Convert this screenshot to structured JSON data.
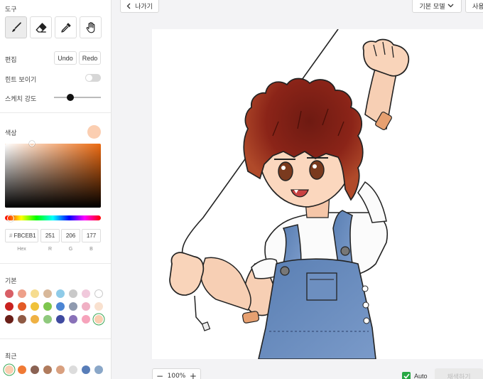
{
  "sidebar": {
    "tools_title": "도구",
    "tools": [
      {
        "name": "brush",
        "active": true
      },
      {
        "name": "eraser",
        "active": false
      },
      {
        "name": "eyedropper",
        "active": false
      },
      {
        "name": "hand",
        "active": false
      }
    ],
    "edit_title": "편집",
    "undo_label": "Undo",
    "redo_label": "Redo",
    "hint_label": "힌트 보이기",
    "hint_enabled": false,
    "strength_label": "스케치 강도",
    "strength_value": 0.35,
    "color_title": "색상",
    "current_color": "#FBCEB1",
    "hex_prefix": "#",
    "hex_value": "FBCEB1",
    "r_value": "251",
    "g_value": "206",
    "b_value": "177",
    "hex_label": "Hex",
    "r_label": "R",
    "g_label": "G",
    "b_label": "B",
    "basic_title": "기본",
    "basic_colors": [
      [
        "#d85f66",
        "#eea08a",
        "#f6dc8f",
        "#d8b89a",
        "#8fcbe8",
        "#c9c9c9",
        "#f1c9dc",
        "#ffffff"
      ],
      [
        "#c9211f",
        "#e35a26",
        "#f0c23a",
        "#7dc64e",
        "#4b85d4",
        "#8f9aaf",
        "#f0b0c4",
        "#f9e1cf"
      ],
      [
        "#6a1f18",
        "#8f5a44",
        "#efb143",
        "#8fc97d",
        "#3f4aa0",
        "#8971b8",
        "#f6a3bb",
        "#fbceb1"
      ]
    ],
    "recent_title": "최근",
    "recent_colors": [
      "#fbceb1",
      "#f07a35",
      "#8a6253",
      "#b07b5d",
      "#d9a07f",
      "#dcdcdc",
      "#587db8",
      "#8aa7c8"
    ]
  },
  "topbar": {
    "back_label": "나가기",
    "model_label": "기본 모델",
    "use_label": "사용법"
  },
  "bottombar": {
    "zoom_minus": "−",
    "zoom_value": "100%",
    "zoom_plus": "+",
    "auto_label": "Auto",
    "auto_checked": true,
    "generate_label": "채색하기"
  }
}
